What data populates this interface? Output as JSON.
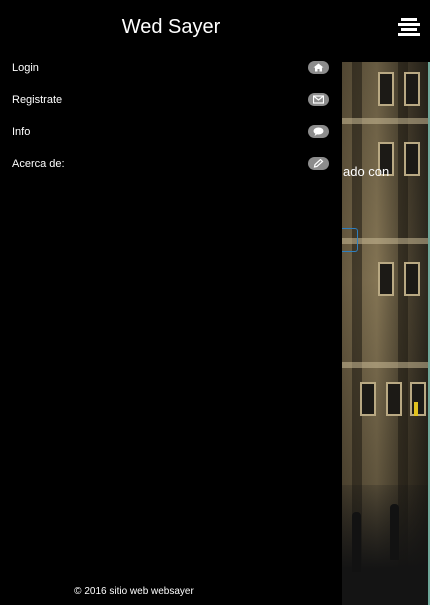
{
  "header": {
    "title": "Wed Sayer",
    "menu_icon": "hamburger-icon"
  },
  "menu": {
    "items": [
      {
        "label": "Login",
        "icon": "home-icon"
      },
      {
        "label": "Registrate",
        "icon": "envelope-icon"
      },
      {
        "label": "Info",
        "icon": "speech-bubble-icon"
      },
      {
        "label": "Acerca de:",
        "icon": "pencil-icon"
      }
    ]
  },
  "background": {
    "partial_text": "ado con"
  },
  "footer": {
    "text": "© 2016 sitio web websayer"
  },
  "colors": {
    "drawer_bg": "#000000",
    "pill_bg": "#8c8c8c",
    "accent_border": "#2f7fbf"
  }
}
